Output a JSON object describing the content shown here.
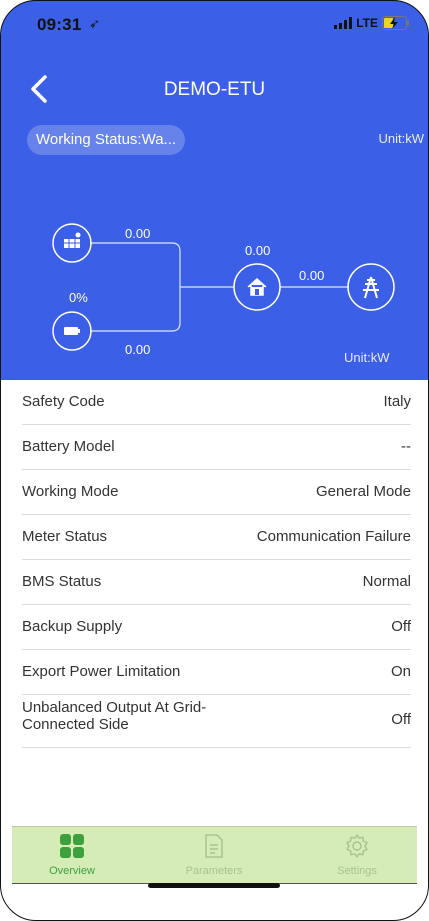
{
  "status_bar": {
    "time": "09:31",
    "network": "LTE"
  },
  "nav": {
    "title": "DEMO-ETU"
  },
  "header": {
    "working_status": "Working Status:Wa...",
    "unit_top": "Unit:kW",
    "unit_bottom": "Unit:kW"
  },
  "diagram": {
    "pv_power": "0.00",
    "battery_soc": "0%",
    "battery_power": "0.00",
    "load_power": "0.00",
    "grid_power": "0.00"
  },
  "details": [
    {
      "label": "Safety Code",
      "value": "Italy"
    },
    {
      "label": "Battery Model",
      "value": "--"
    },
    {
      "label": "Working Mode",
      "value": "General Mode"
    },
    {
      "label": "Meter Status",
      "value": "Communication Failure"
    },
    {
      "label": "BMS Status",
      "value": "Normal"
    },
    {
      "label": "Backup Supply",
      "value": "Off"
    },
    {
      "label": "Export Power Limitation",
      "value": "On"
    },
    {
      "label": "Unbalanced Output At Grid-Connected Side",
      "value": "Off"
    }
  ],
  "tabs": [
    {
      "label": "Overview",
      "icon": "grid-icon",
      "active": true
    },
    {
      "label": "Parameters",
      "icon": "document-icon",
      "active": false
    },
    {
      "label": "Settings",
      "icon": "gear-icon",
      "active": false
    }
  ],
  "colors": {
    "header_bg": "#3b5fe6",
    "tab_active": "#3ea03c",
    "tab_inactive": "#a8c38c",
    "tabbar_bg": "#d5ecb6"
  }
}
